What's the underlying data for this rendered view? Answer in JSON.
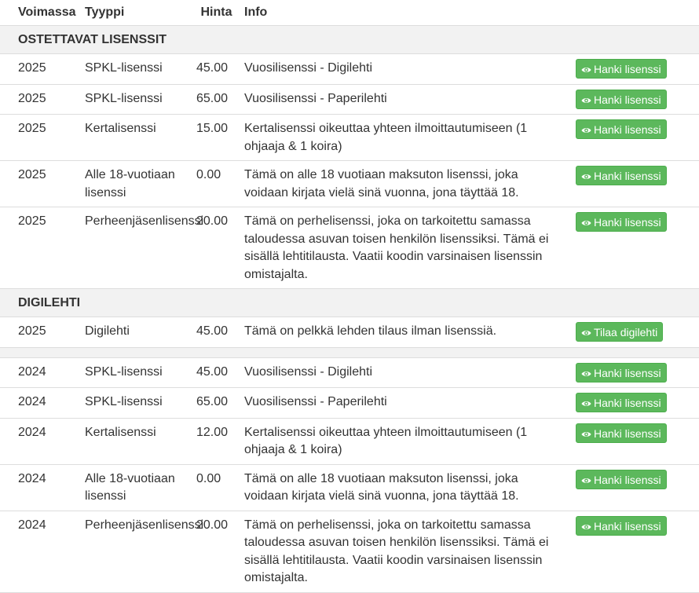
{
  "table": {
    "headers": {
      "valid": "Voimassa",
      "type": "Tyyppi",
      "price": "Hinta",
      "info": "Info"
    }
  },
  "sections": {
    "licenses": "OSTETTAVAT LISENSSIT",
    "digilehti": "DIGILEHTI"
  },
  "buttons": {
    "get_license": "Hanki lisenssi",
    "order_digi": "Tilaa digilehti"
  },
  "icons": {
    "button_icon": "eye-icon"
  },
  "colors": {
    "button_bg": "#5cb85c",
    "section_bg": "#f2f2f2",
    "border": "#dddddd"
  },
  "rows_licenses_2025": [
    {
      "year": "2025",
      "type": "SPKL-lisenssi",
      "price": "45.00",
      "info": "Vuosilisenssi - Digilehti"
    },
    {
      "year": "2025",
      "type": "SPKL-lisenssi",
      "price": "65.00",
      "info": "Vuosilisenssi - Paperilehti"
    },
    {
      "year": "2025",
      "type": "Kertalisenssi",
      "price": "15.00",
      "info": "Kertalisenssi oikeuttaa yhteen ilmoittautumiseen (1 ohjaaja & 1 koira)"
    },
    {
      "year": "2025",
      "type": "Alle 18-vuotiaan lisenssi",
      "price": "0.00",
      "info": "Tämä on alle 18 vuotiaan maksuton lisenssi, joka voidaan kirjata vielä sinä vuonna, jona täyttää 18."
    },
    {
      "year": "2025",
      "type": "Perheenjäsenlisenssi",
      "price": "20.00",
      "info": "Tämä on perhelisenssi, joka on tarkoitettu samassa taloudessa asuvan toisen henkilön lisenssiksi. Tämä ei sisällä lehtitilausta. Vaatii koodin varsinaisen lisenssin omistajalta."
    }
  ],
  "rows_digilehti": [
    {
      "year": "2025",
      "type": "Digilehti",
      "price": "45.00",
      "info": "Tämä on pelkkä lehden tilaus ilman lisenssiä."
    }
  ],
  "rows_licenses_2024": [
    {
      "year": "2024",
      "type": "SPKL-lisenssi",
      "price": "45.00",
      "info": "Vuosilisenssi - Digilehti"
    },
    {
      "year": "2024",
      "type": "SPKL-lisenssi",
      "price": "65.00",
      "info": "Vuosilisenssi - Paperilehti"
    },
    {
      "year": "2024",
      "type": "Kertalisenssi",
      "price": "12.00",
      "info": "Kertalisenssi oikeuttaa yhteen ilmoittautumiseen (1 ohjaaja & 1 koira)"
    },
    {
      "year": "2024",
      "type": "Alle 18-vuotiaan lisenssi",
      "price": "0.00",
      "info": "Tämä on alle 18 vuotiaan maksuton lisenssi, joka voidaan kirjata vielä sinä vuonna, jona täyttää 18."
    },
    {
      "year": "2024",
      "type": "Perheenjäsenlisenssi",
      "price": "20.00",
      "info": "Tämä on perhelisenssi, joka on tarkoitettu samassa taloudessa asuvan toisen henkilön lisenssiksi. Tämä ei sisällä lehtitilausta. Vaatii koodin varsinaisen lisenssin omistajalta."
    }
  ]
}
